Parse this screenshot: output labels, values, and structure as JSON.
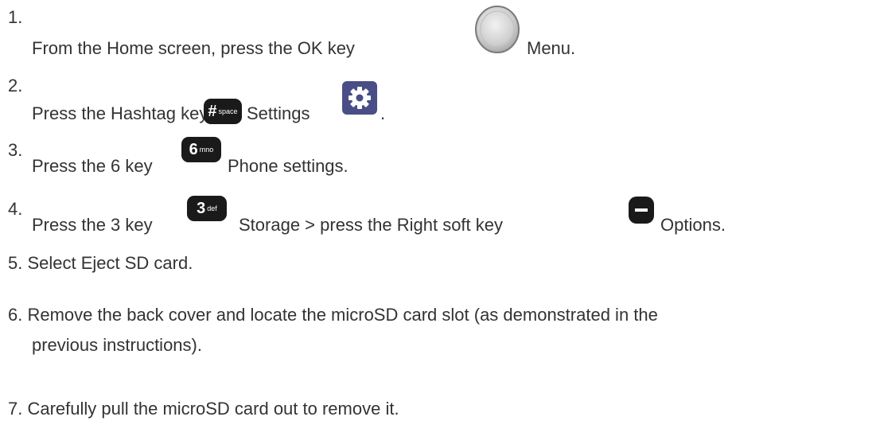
{
  "steps": [
    {
      "number": "1.",
      "parts": [
        "From the Home screen, press the OK key",
        "Menu."
      ],
      "icons": [
        "ok-key-icon"
      ]
    },
    {
      "number": "2.",
      "parts": [
        "Press the Hashtag key",
        "Settings",
        "."
      ],
      "icons": [
        "hashtag-key-icon",
        "settings-gear-icon"
      ]
    },
    {
      "number": "3.",
      "parts": [
        "Press the 6 key",
        "Phone settings."
      ],
      "icons": [
        "six-mno-key-icon"
      ]
    },
    {
      "number": "4.",
      "parts": [
        "Press the 3 key",
        "Storage > press the Right soft key",
        "Options."
      ],
      "icons": [
        "three-def-key-icon",
        "right-soft-key-icon"
      ]
    },
    {
      "number": "5.",
      "text": "Select Eject SD card."
    },
    {
      "number": "6.",
      "text_line1": "Remove the back cover and locate the microSD card slot (as demonstrated in the",
      "text_line2": "previous instructions)."
    },
    {
      "number": "7.",
      "text": "Carefully pull the microSD card out to remove it."
    }
  ],
  "keycaps": {
    "hashtag": {
      "big": "#",
      "small": "space"
    },
    "six": {
      "big": "6",
      "small": "mno"
    },
    "three": {
      "big": "3",
      "small": "def"
    }
  },
  "colors": {
    "text": "#333333",
    "keycap": "#1a1a1a",
    "settings_tile": "#4a4e86",
    "ok_key_fill": "#d9d9d9"
  }
}
